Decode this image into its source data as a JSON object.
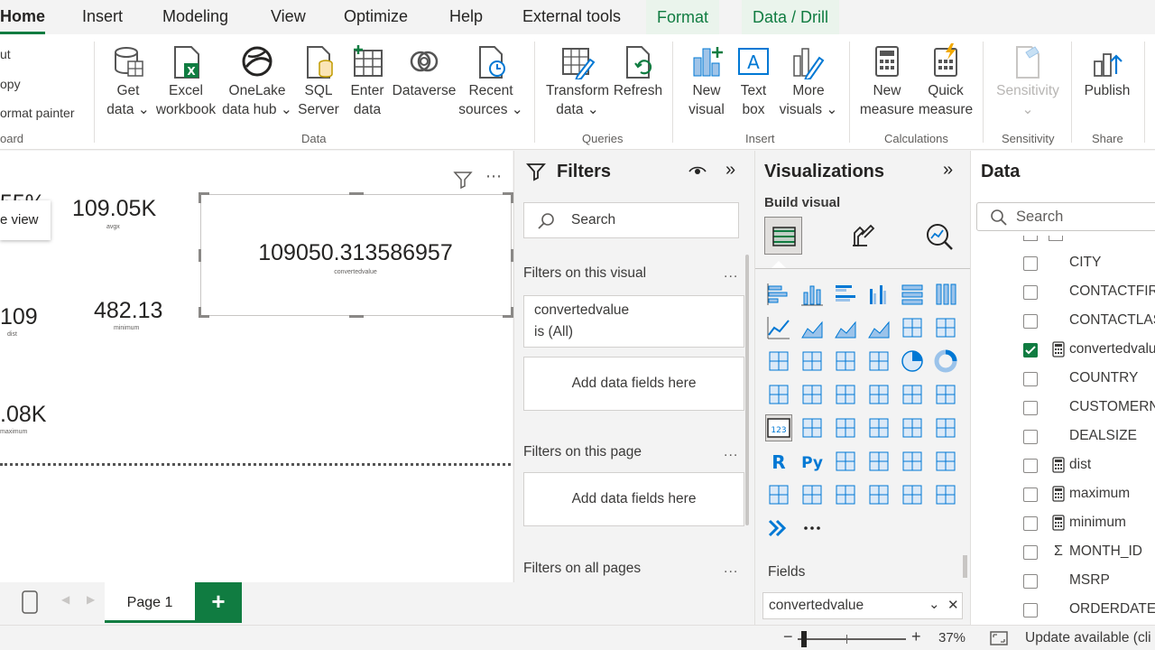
{
  "menu": {
    "tabs": [
      "Home",
      "Insert",
      "Modeling",
      "View",
      "Optimize",
      "Help",
      "External tools"
    ],
    "context_tabs": [
      "Format",
      "Data / Drill"
    ]
  },
  "ribbon": {
    "clipboard": {
      "cut": "ut",
      "copy": "opy",
      "format_painter": "ormat painter",
      "group": "oard"
    },
    "data": {
      "items": [
        {
          "line1": "Get",
          "line2": "data ⌄"
        },
        {
          "line1": "Excel",
          "line2": "workbook"
        },
        {
          "line1": "OneLake",
          "line2": "data hub ⌄"
        },
        {
          "line1": "SQL",
          "line2": "Server"
        },
        {
          "line1": "Enter",
          "line2": "data"
        },
        {
          "line1": "Dataverse",
          "line2": ""
        },
        {
          "line1": "Recent",
          "line2": "sources ⌄"
        }
      ],
      "group": "Data"
    },
    "queries": {
      "items": [
        {
          "line1": "Transform",
          "line2": "data ⌄"
        },
        {
          "line1": "Refresh",
          "line2": ""
        }
      ],
      "group": "Queries"
    },
    "insert": {
      "items": [
        {
          "line1": "New",
          "line2": "visual"
        },
        {
          "line1": "Text",
          "line2": "box"
        },
        {
          "line1": "More",
          "line2": "visuals ⌄"
        }
      ],
      "group": "Insert"
    },
    "calculations": {
      "items": [
        {
          "line1": "New",
          "line2": "measure"
        },
        {
          "line1": "Quick",
          "line2": "measure"
        }
      ],
      "group": "Calculations"
    },
    "sensitivity": {
      "label": "Sensitivity",
      "arrow": "⌄",
      "group": "Sensitivity"
    },
    "share": {
      "label": "Publish",
      "group": "Share"
    }
  },
  "canvas": {
    "tooltip": "e view",
    "partial_top": "55%",
    "kpis": [
      {
        "value": "109.05K",
        "label": "avgx"
      },
      {
        "value": "109",
        "label": "dist"
      },
      {
        "value": "482.13",
        "label": "minimum"
      },
      {
        "value": ".08K",
        "label": "maximum"
      }
    ],
    "card": {
      "value": "109050.313586957",
      "label": "convertedvalue"
    }
  },
  "pages": {
    "page1": "Page 1",
    "add": "+"
  },
  "status": {
    "zoom": "37%",
    "minus": "−",
    "plus": "+",
    "update": "Update available (cli"
  },
  "filters": {
    "title": "Filters",
    "search_placeholder": "Search",
    "on_visual": "Filters on this visual",
    "card_field": "convertedvalue",
    "card_condition": "is (All)",
    "add_fields": "Add data fields here",
    "on_page": "Filters on this page",
    "add_fields_page": "Add data fields here",
    "on_all": "Filters on all pages",
    "more": "..."
  },
  "visualizations": {
    "title": "Visualizations",
    "build_visual": "Build visual",
    "fields_label": "Fields",
    "field_value": "convertedvalue",
    "more_icon": "..."
  },
  "data": {
    "title": "Data",
    "search_placeholder": "Search",
    "fields": [
      {
        "name": "CITY",
        "checked": false,
        "type": ""
      },
      {
        "name": "CONTACTFIRS",
        "checked": false,
        "type": ""
      },
      {
        "name": "CONTACTLAS",
        "checked": false,
        "type": ""
      },
      {
        "name": "convertedvalu",
        "checked": true,
        "type": "calc"
      },
      {
        "name": "COUNTRY",
        "checked": false,
        "type": ""
      },
      {
        "name": "CUSTOMERNA",
        "checked": false,
        "type": ""
      },
      {
        "name": "DEALSIZE",
        "checked": false,
        "type": ""
      },
      {
        "name": "dist",
        "checked": false,
        "type": "calc"
      },
      {
        "name": "maximum",
        "checked": false,
        "type": "calc"
      },
      {
        "name": "minimum",
        "checked": false,
        "type": "calc"
      },
      {
        "name": "MONTH_ID",
        "checked": false,
        "type": "sum"
      },
      {
        "name": "MSRP",
        "checked": false,
        "type": ""
      },
      {
        "name": "ORDERDATE",
        "checked": false,
        "type": ""
      }
    ]
  }
}
